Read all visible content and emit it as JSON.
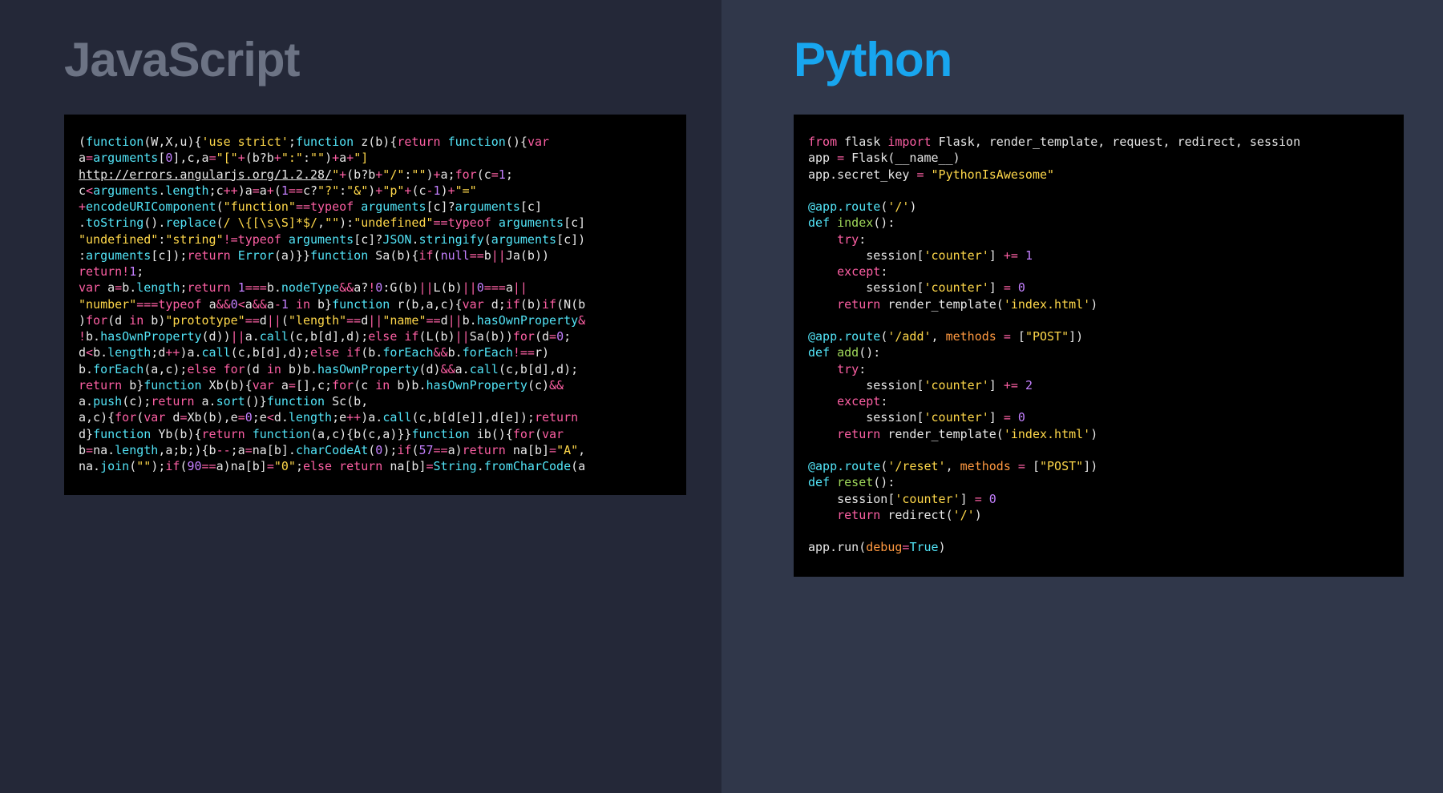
{
  "left": {
    "title": "JavaScript",
    "code_html": "<span class='w'>(</span><span class='c'>function</span><span class='w'>(W,X,u){</span><span class='y'>'use strict'</span><span class='w'>;</span><span class='c'>function</span><span class='w'> z(b){</span><span class='p'>return</span> <span class='c'>function</span><span class='w'>(){</span><span class='p'>var</span>\n<span class='w'>a</span><span class='p'>=</span><span class='c'>arguments</span><span class='w'>[</span><span class='m'>0</span><span class='w'>],c,a</span><span class='p'>=</span><span class='y'>\"[\"</span><span class='p'>+</span><span class='w'>(b?b</span><span class='p'>+</span><span class='y'>\":\"</span><span class='w'>:</span><span class='y'>\"\"</span><span class='w'>)</span><span class='p'>+</span><span class='w'>a</span><span class='p'>+</span><span class='y'>\"]</span>\n<span class='lk'>http://errors.angularjs.org/1.2.28/</span><span class='y'>\"</span><span class='p'>+</span><span class='w'>(b?b</span><span class='p'>+</span><span class='y'>\"/\"</span><span class='w'>:</span><span class='y'>\"\"</span><span class='w'>)</span><span class='p'>+</span><span class='w'>a;</span><span class='p'>for</span><span class='w'>(c</span><span class='p'>=</span><span class='m'>1</span><span class='w'>;</span>\n<span class='w'>c</span><span class='p'>&lt;</span><span class='c'>arguments</span><span class='w'>.</span><span class='c'>length</span><span class='w'>;c</span><span class='p'>++</span><span class='w'>)a</span><span class='p'>=</span><span class='w'>a</span><span class='p'>+</span><span class='w'>(</span><span class='m'>1</span><span class='p'>==</span><span class='w'>c?</span><span class='y'>\"?\"</span><span class='w'>:</span><span class='y'>\"&amp;\"</span><span class='w'>)</span><span class='p'>+</span><span class='y'>\"p\"</span><span class='p'>+</span><span class='w'>(c</span><span class='p'>-</span><span class='m'>1</span><span class='w'>)</span><span class='p'>+</span><span class='y'>\"=\"</span>\n<span class='p'>+</span><span class='c'>encodeURIComponent</span><span class='w'>(</span><span class='y'>\"function\"</span><span class='p'>==typeof</span> <span class='c'>arguments</span><span class='w'>[c]?</span><span class='c'>arguments</span><span class='w'>[c]</span>\n<span class='w'>.</span><span class='c'>toString</span><span class='w'>().</span><span class='c'>replace</span><span class='w'>(</span><span class='y'>/ \\{[\\s\\S]*$/</span><span class='w'>,</span><span class='y'>\"\"</span><span class='w'>):</span><span class='y'>\"undefined\"</span><span class='p'>==typeof</span> <span class='c'>arguments</span><span class='w'>[c]</span>\n<span class='y'>\"undefined\"</span><span class='w'>:</span><span class='y'>\"string\"</span><span class='p'>!=typeof</span> <span class='c'>arguments</span><span class='w'>[c]?</span><span class='c'>JSON</span><span class='w'>.</span><span class='c'>stringify</span><span class='w'>(</span><span class='c'>arguments</span><span class='w'>[c])</span>\n<span class='w'>:</span><span class='c'>arguments</span><span class='w'>[c]);</span><span class='p'>return</span> <span class='c'>Error</span><span class='w'>(a)}}</span><span class='c'>function</span><span class='w'> Sa(b){</span><span class='p'>if</span><span class='w'>(</span><span class='m'>null</span><span class='p'>==</span><span class='w'>b</span><span class='p'>||</span><span class='w'>Ja(b))</span>\n<span class='p'>return!</span><span class='m'>1</span><span class='w'>;</span>\n<span class='p'>var</span> <span class='w'>a</span><span class='p'>=</span><span class='w'>b.</span><span class='c'>length</span><span class='w'>;</span><span class='p'>return</span> <span class='m'>1</span><span class='p'>===</span><span class='w'>b.</span><span class='c'>nodeType</span><span class='p'>&amp;&amp;</span><span class='w'>a?</span><span class='p'>!</span><span class='m'>0</span><span class='w'>:G(b)</span><span class='p'>||</span><span class='w'>L(b)</span><span class='p'>||</span><span class='m'>0</span><span class='p'>===</span><span class='w'>a</span><span class='p'>||</span>\n<span class='y'>\"number\"</span><span class='p'>===typeof</span> <span class='w'>a</span><span class='p'>&amp;&amp;</span><span class='m'>0</span><span class='p'>&lt;</span><span class='w'>a</span><span class='p'>&amp;&amp;</span><span class='w'>a</span><span class='p'>-</span><span class='m'>1</span> <span class='p'>in</span> <span class='w'>b}</span><span class='c'>function</span><span class='w'> r(b,a,c){</span><span class='p'>var</span> <span class='w'>d;</span><span class='p'>if</span><span class='w'>(b)</span><span class='p'>if</span><span class='w'>(N(b</span>\n<span class='w'>)</span><span class='p'>for</span><span class='w'>(d </span><span class='p'>in</span><span class='w'> b)</span><span class='y'>\"prototype\"</span><span class='p'>==</span><span class='w'>d</span><span class='p'>||</span><span class='w'>(</span><span class='y'>\"length\"</span><span class='p'>==</span><span class='w'>d</span><span class='p'>||</span><span class='y'>\"name\"</span><span class='p'>==</span><span class='w'>d</span><span class='p'>||</span><span class='w'>b.</span><span class='c'>hasOwnProperty</span><span class='p'>&amp;</span>\n<span class='p'>!</span><span class='w'>b.</span><span class='c'>hasOwnProperty</span><span class='w'>(d))</span><span class='p'>||</span><span class='w'>a.</span><span class='c'>call</span><span class='w'>(c,b[d],d);</span><span class='p'>else if</span><span class='w'>(L(b)</span><span class='p'>||</span><span class='w'>Sa(b))</span><span class='p'>for</span><span class='w'>(d</span><span class='p'>=</span><span class='m'>0</span><span class='w'>;</span>\n<span class='w'>d</span><span class='p'>&lt;</span><span class='w'>b.</span><span class='c'>length</span><span class='w'>;d</span><span class='p'>++</span><span class='w'>)a.</span><span class='c'>call</span><span class='w'>(c,b[d],d);</span><span class='p'>else if</span><span class='w'>(b.</span><span class='c'>forEach</span><span class='p'>&amp;&amp;</span><span class='w'>b.</span><span class='c'>forEach</span><span class='p'>!==</span><span class='w'>r)</span>\n<span class='w'>b.</span><span class='c'>forEach</span><span class='w'>(a,c);</span><span class='p'>else for</span><span class='w'>(d </span><span class='p'>in</span><span class='w'> b)b.</span><span class='c'>hasOwnProperty</span><span class='w'>(d)</span><span class='p'>&amp;&amp;</span><span class='w'>a.</span><span class='c'>call</span><span class='w'>(c,b[d],d);</span>\n<span class='p'>return</span> <span class='w'>b}</span><span class='c'>function</span><span class='w'> Xb(b){</span><span class='p'>var</span> <span class='w'>a</span><span class='p'>=</span><span class='w'>[],c;</span><span class='p'>for</span><span class='w'>(c </span><span class='p'>in</span><span class='w'> b)b.</span><span class='c'>hasOwnProperty</span><span class='w'>(c)</span><span class='p'>&amp;&amp;</span>\n<span class='w'>a.</span><span class='c'>push</span><span class='w'>(c);</span><span class='p'>return</span> <span class='w'>a.</span><span class='c'>sort</span><span class='w'>()}</span><span class='c'>function</span><span class='w'> Sc(b,</span>\n<span class='w'>a,c){</span><span class='p'>for</span><span class='w'>(</span><span class='p'>var</span><span class='w'> d</span><span class='p'>=</span><span class='w'>Xb(b),e</span><span class='p'>=</span><span class='m'>0</span><span class='w'>;e</span><span class='p'>&lt;</span><span class='w'>d.</span><span class='c'>length</span><span class='w'>;e</span><span class='p'>++</span><span class='w'>)a.</span><span class='c'>call</span><span class='w'>(c,b[d[e]],d[e]);</span><span class='p'>return</span>\n<span class='w'>d}</span><span class='c'>function</span><span class='w'> Yb(b){</span><span class='p'>return</span> <span class='c'>function</span><span class='w'>(a,c){b(c,a)}}</span><span class='c'>function</span><span class='w'> ib(){</span><span class='p'>for</span><span class='w'>(</span><span class='p'>var</span>\n<span class='w'>b</span><span class='p'>=</span><span class='w'>na.</span><span class='c'>length</span><span class='w'>,a;b;){b</span><span class='p'>--</span><span class='w'>;a</span><span class='p'>=</span><span class='w'>na[b].</span><span class='c'>charCodeAt</span><span class='w'>(</span><span class='m'>0</span><span class='w'>);</span><span class='p'>if</span><span class='w'>(</span><span class='m'>57</span><span class='p'>==</span><span class='w'>a)</span><span class='p'>return</span> <span class='w'>na[b]</span><span class='p'>=</span><span class='y'>\"A\"</span><span class='w'>,</span>\n<span class='w'>na.</span><span class='c'>join</span><span class='w'>(</span><span class='y'>\"\"</span><span class='w'>);</span><span class='p'>if</span><span class='w'>(</span><span class='m'>90</span><span class='p'>==</span><span class='w'>a)na[b]</span><span class='p'>=</span><span class='y'>\"0\"</span><span class='w'>;</span><span class='p'>else return</span> <span class='w'>na[b]</span><span class='p'>=</span><span class='c'>String</span><span class='w'>.</span><span class='c'>fromCharCode</span><span class='w'>(a</span>"
  },
  "right": {
    "title": "Python",
    "code_html": "<span class='p'>from</span> <span class='w'>flask</span> <span class='p'>import</span> <span class='w'>Flask, render_template, request, redirect, session</span>\n<span class='w'>app </span><span class='p'>=</span><span class='w'> Flask(__name__)</span>\n<span class='w'>app.secret_key </span><span class='p'>=</span> <span class='y'>\"PythonIsAwesome\"</span>\n\n<span class='c'>@app.route</span><span class='w'>(</span><span class='y'>'/'</span><span class='w'>)</span>\n<span class='c'>def</span> <span class='g'>index</span><span class='w'>():</span>\n    <span class='p'>try</span><span class='w'>:</span>\n        <span class='w'>session[</span><span class='y'>'counter'</span><span class='w'>] </span><span class='p'>+=</span> <span class='m'>1</span>\n    <span class='p'>except</span><span class='w'>:</span>\n        <span class='w'>session[</span><span class='y'>'counter'</span><span class='w'>] </span><span class='p'>=</span> <span class='m'>0</span>\n    <span class='p'>return</span> <span class='w'>render_template(</span><span class='y'>'index.html'</span><span class='w'>)</span>\n\n<span class='c'>@app.route</span><span class='w'>(</span><span class='y'>'/add'</span><span class='w'>, </span><span class='o'>methods</span> <span class='p'>=</span> <span class='w'>[</span><span class='y'>\"POST\"</span><span class='w'>])</span>\n<span class='c'>def</span> <span class='g'>add</span><span class='w'>():</span>\n    <span class='p'>try</span><span class='w'>:</span>\n        <span class='w'>session[</span><span class='y'>'counter'</span><span class='w'>] </span><span class='p'>+=</span> <span class='m'>2</span>\n    <span class='p'>except</span><span class='w'>:</span>\n        <span class='w'>session[</span><span class='y'>'counter'</span><span class='w'>] </span><span class='p'>=</span> <span class='m'>0</span>\n    <span class='p'>return</span> <span class='w'>render_template(</span><span class='y'>'index.html'</span><span class='w'>)</span>\n\n<span class='c'>@app.route</span><span class='w'>(</span><span class='y'>'/reset'</span><span class='w'>, </span><span class='o'>methods</span> <span class='p'>=</span> <span class='w'>[</span><span class='y'>\"POST\"</span><span class='w'>])</span>\n<span class='c'>def</span> <span class='g'>reset</span><span class='w'>():</span>\n    <span class='w'>session[</span><span class='y'>'counter'</span><span class='w'>] </span><span class='p'>=</span> <span class='m'>0</span>\n    <span class='p'>return</span> <span class='w'>redirect(</span><span class='y'>'/'</span><span class='w'>)</span>\n\n<span class='w'>app.run(</span><span class='o'>debug</span><span class='p'>=</span><span class='c'>True</span><span class='w'>)</span>"
  }
}
